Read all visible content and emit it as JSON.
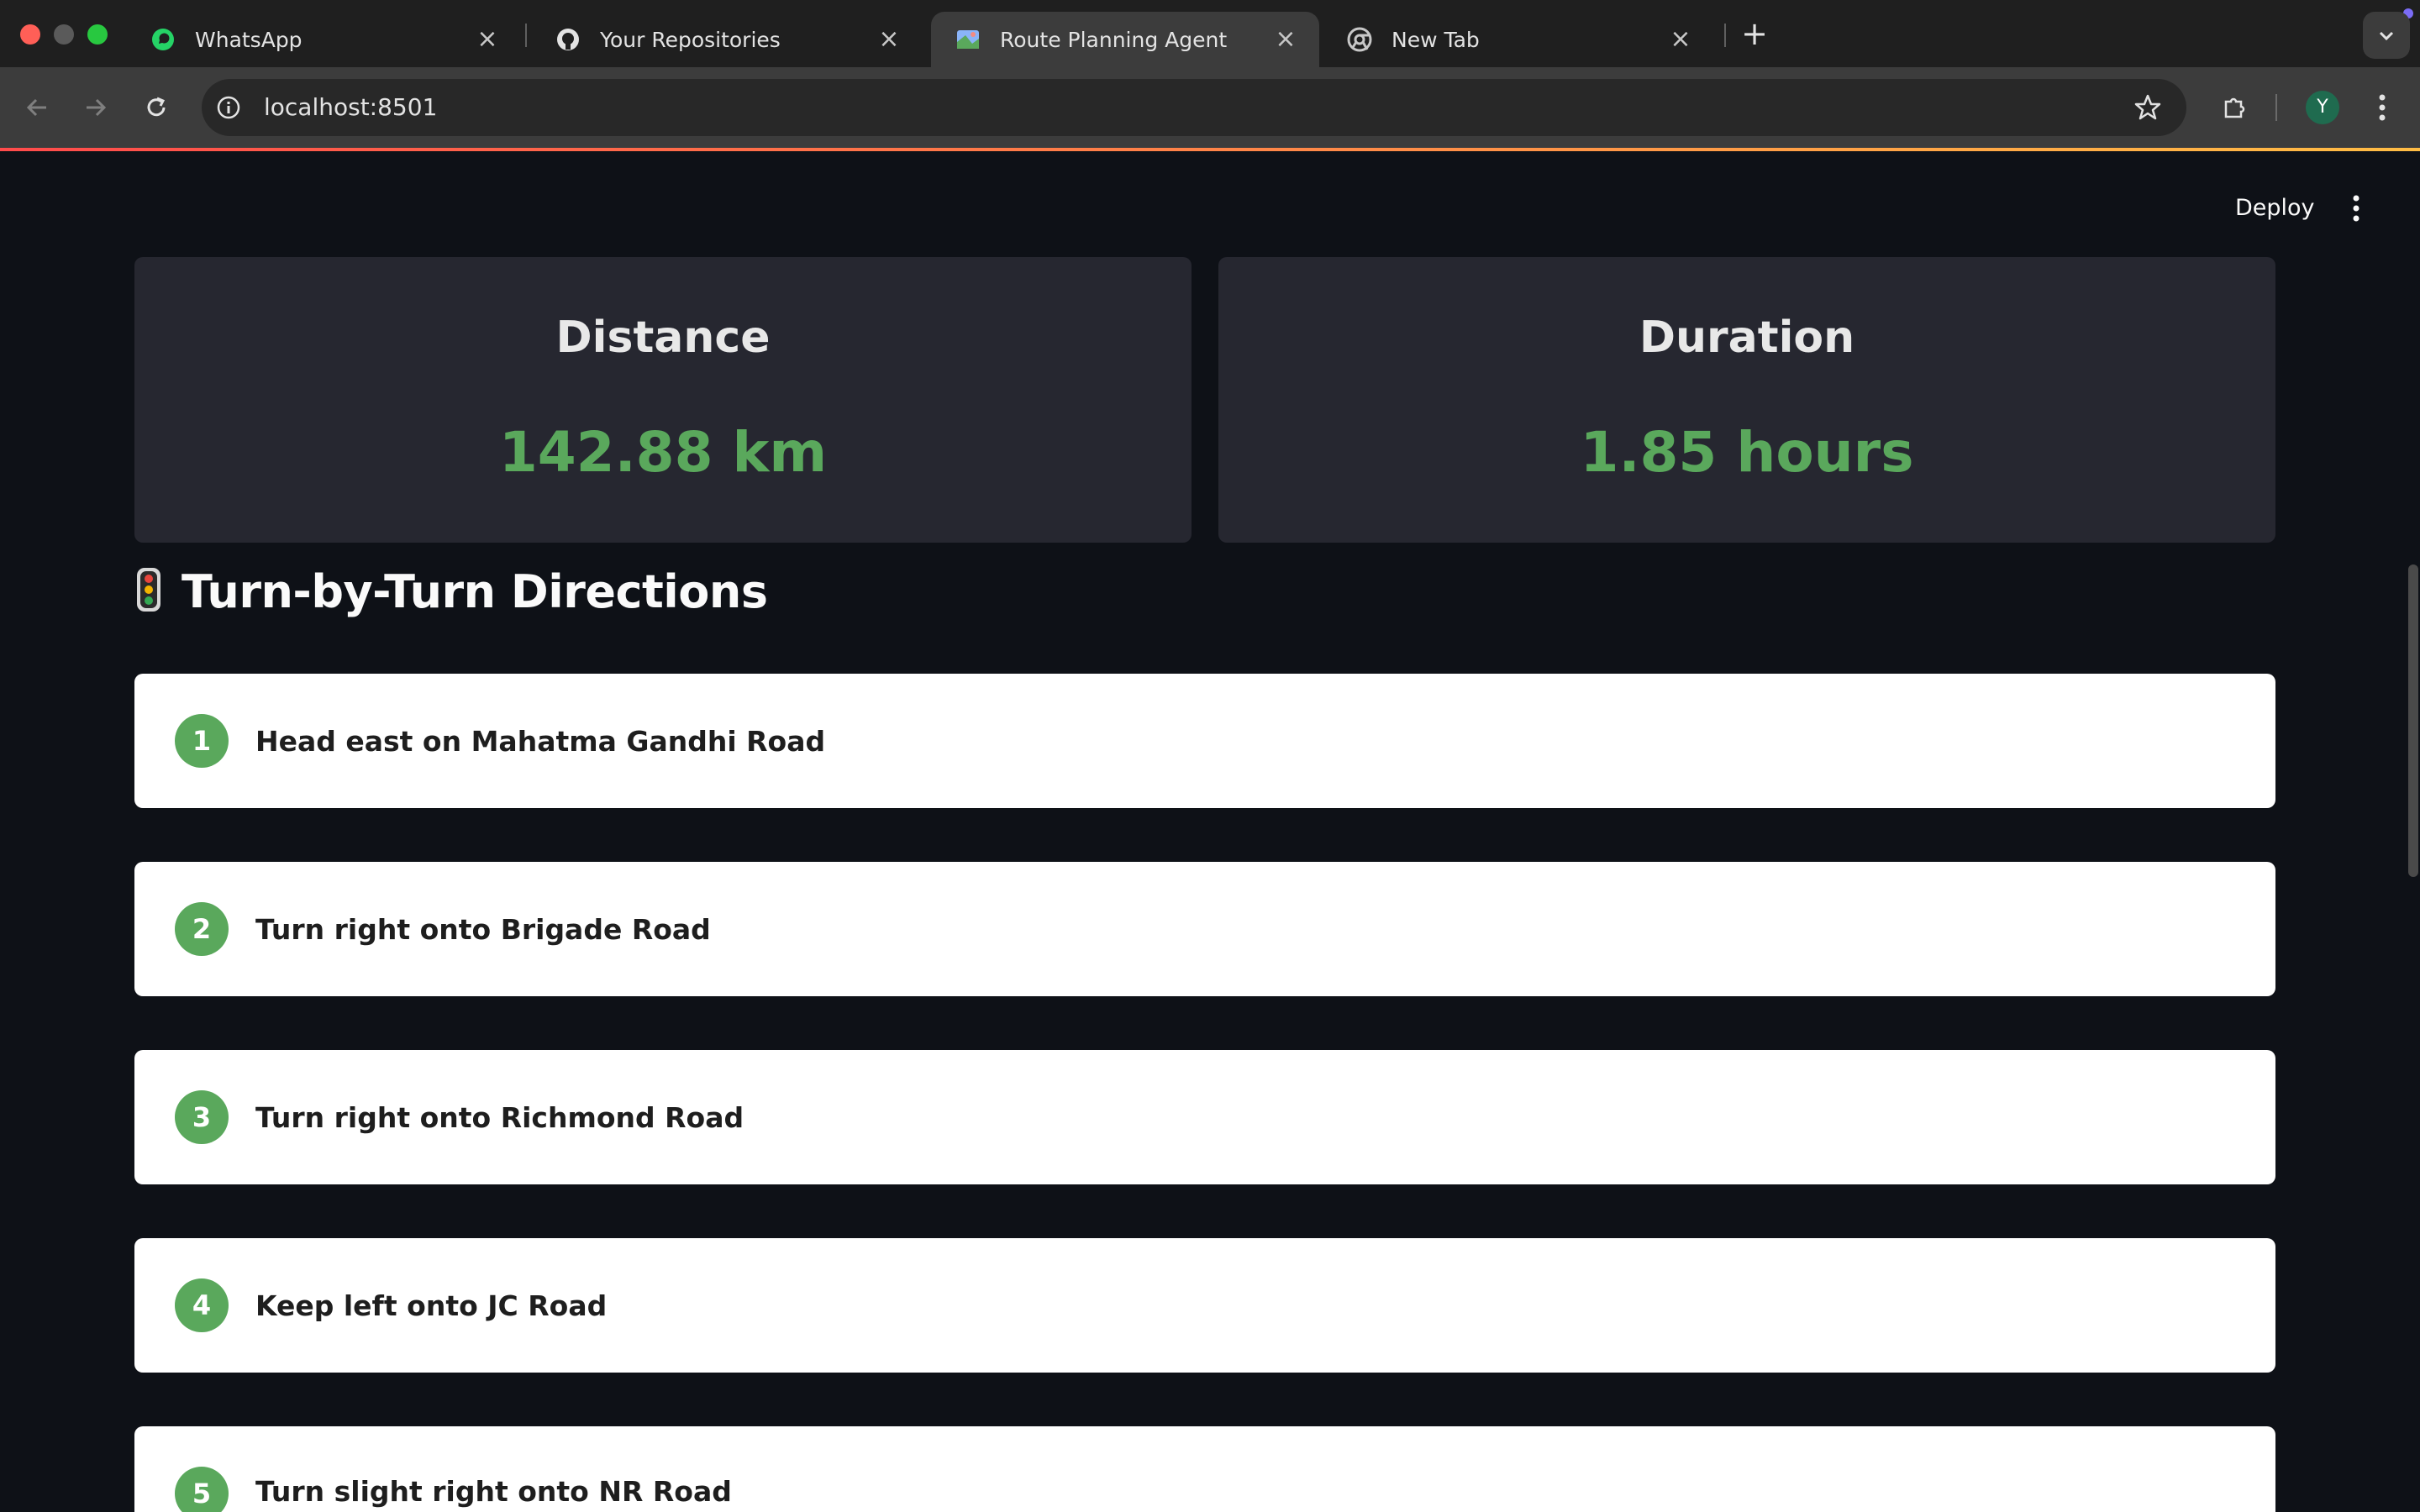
{
  "browser": {
    "tabs": [
      {
        "title": "WhatsApp",
        "icon": "whatsapp-icon",
        "active": false
      },
      {
        "title": "Your Repositories",
        "icon": "github-icon",
        "active": false
      },
      {
        "title": "Route Planning Agent",
        "icon": "map-icon",
        "active": true
      },
      {
        "title": "New Tab",
        "icon": "chrome-icon",
        "active": false
      }
    ],
    "address_bar": {
      "url": "localhost:8501"
    },
    "profile_initial": "Y"
  },
  "app": {
    "deploy_label": "Deploy",
    "metrics": [
      {
        "label": "Distance",
        "value": "142.88 km"
      },
      {
        "label": "Duration",
        "value": "1.85 hours"
      }
    ],
    "directions": {
      "icon": "traffic-light-icon",
      "heading": "Turn-by-Turn Directions",
      "steps": [
        {
          "number": "1",
          "text": "Head east on Mahatma Gandhi Road"
        },
        {
          "number": "2",
          "text": "Turn right onto Brigade Road"
        },
        {
          "number": "3",
          "text": "Turn right onto Richmond Road"
        },
        {
          "number": "4",
          "text": "Keep left onto JC Road"
        },
        {
          "number": "5",
          "text": "Turn slight right onto NR Road"
        }
      ]
    }
  },
  "colors": {
    "accent_green": "#5aa85c",
    "app_background": "#0e1117",
    "card_background": "#262730"
  }
}
